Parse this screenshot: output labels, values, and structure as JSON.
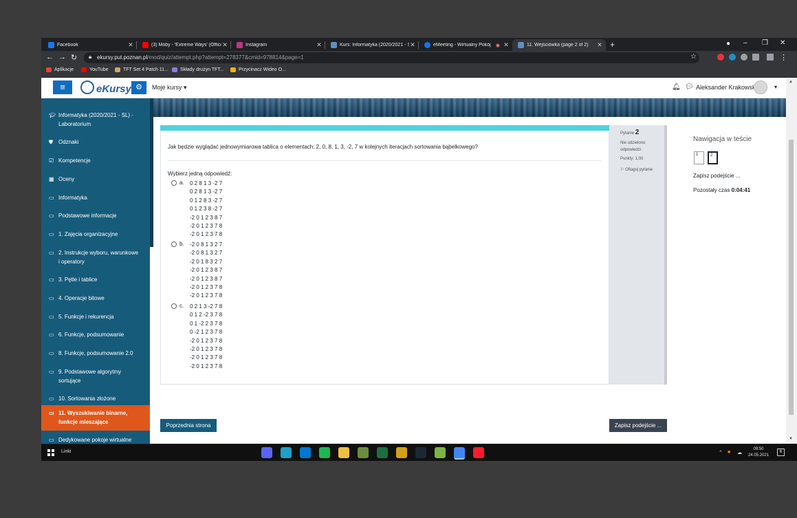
{
  "browser": {
    "tabs": [
      {
        "title": "Facebook",
        "favicon_color": "#1877f2"
      },
      {
        "title": "(3) Moby - 'Extreme Ways' (Offici",
        "favicon_color": "#ff0000"
      },
      {
        "title": "Instagram",
        "favicon_color": "#c13584"
      },
      {
        "title": "Kurs: Informatyka (2020/2021 - S",
        "favicon_color": "#5d8fc4"
      },
      {
        "title": "eMeeting - Wirtualny Pokój",
        "favicon_color": "#1a73e8"
      },
      {
        "title": "11. Wejściówka (page 2 of 2)",
        "favicon_color": "#5d8fc4"
      }
    ],
    "new_tab": "+",
    "window_controls": {
      "minimize": "–",
      "restore": "❐",
      "close": "✕"
    },
    "url_host": "ekursy.put.poznan.pl",
    "url_path": "/mod/quiz/attempt.php?attempt=278377&cmid=978814&page=1",
    "bookmarks": [
      {
        "label": "Aplikacje",
        "color": "#e94235"
      },
      {
        "label": "YouTube",
        "color": "#ff0000"
      },
      {
        "label": "TFT Set 4 Patch 11...",
        "color": "#c8aa6e"
      },
      {
        "label": "Składy drużyn TFT...",
        "color": "#8a7fd6"
      },
      {
        "label": "Przycinacz Wideo O...",
        "color": "#f4b400"
      }
    ]
  },
  "navbar": {
    "logo_text": "eKursy",
    "my_courses": "Moje kursy",
    "user_name": "Aleksander Krakowski"
  },
  "sidebar": {
    "items": [
      {
        "label": "Informatyka (2020/2021 - SL) - Laboratorium",
        "icon": "graduation-cap-icon",
        "glyph": "🎓"
      },
      {
        "label": "Odznaki",
        "icon": "shield-icon",
        "glyph": "⛊"
      },
      {
        "label": "Kompetencje",
        "icon": "checkbox-icon",
        "glyph": "☑"
      },
      {
        "label": "Oceny",
        "icon": "table-icon",
        "glyph": "▦"
      },
      {
        "label": "Informatyka",
        "icon": "folder-icon",
        "glyph": "▭"
      },
      {
        "label": "Podstawowe informacje",
        "icon": "folder-icon",
        "glyph": "▭"
      },
      {
        "label": "1. Zajęcia organizacyjne",
        "icon": "folder-icon",
        "glyph": "▭"
      },
      {
        "label": "2. Instrukcje wyboru, warunkowe i operatory",
        "icon": "folder-icon",
        "glyph": "▭"
      },
      {
        "label": "3. Pętle i tablice",
        "icon": "folder-icon",
        "glyph": "▭"
      },
      {
        "label": "4. Operacje bitowe",
        "icon": "folder-icon",
        "glyph": "▭"
      },
      {
        "label": "5. Funkcje i rekurencja",
        "icon": "folder-icon",
        "glyph": "▭"
      },
      {
        "label": "6. Funkcje, podsumowanie",
        "icon": "folder-icon",
        "glyph": "▭"
      },
      {
        "label": "8. Funkcje, podsumowanie 2.0",
        "icon": "folder-icon",
        "glyph": "▭"
      },
      {
        "label": "9. Podstawowe algorytmy sortujące",
        "icon": "folder-icon",
        "glyph": "▭"
      },
      {
        "label": "10. Sortowania złożone",
        "icon": "folder-icon",
        "glyph": "▭"
      },
      {
        "label": "11. Wyszukiwanie binarne, funkcje mieszające",
        "icon": "folder-icon",
        "glyph": "▭"
      },
      {
        "label": "Dedykowane pokoje wirtualne",
        "icon": "folder-icon",
        "glyph": "▭"
      }
    ]
  },
  "question": {
    "info_label": "Pytanie",
    "number": "2",
    "state": "Nie udzielono odpowiedzi",
    "marks": "Punkty: 1,00",
    "flag": "Oflaguj pytanie",
    "text": "Jak będzie wyglądać jednowymiarowa tablica o elementach: 2, 0, 8, 1, 3, -2, 7 w kolejnych iteracjach sortowania bąbelkowego?",
    "prompt": "Wybierz jedną odpowiedź:",
    "options": [
      {
        "letter": "a.",
        "lines": [
          "0 2 8 1 3 -2 7",
          "0 2 8 1 3 -2 7",
          "0 1 2 8 3 -2 7",
          "0 1 2 3 8 -2 7",
          "-2 0 1 2 3 8 7",
          "-2 0 1 2 3 7 8",
          "-2 0 1 2 3 7 8"
        ]
      },
      {
        "letter": "b.",
        "lines": [
          "-2 0 8 1 3 2 7",
          "-2 0 8 1 3 2 7",
          "-2 0 1 8 3 2 7",
          "-2 0 1 2 3 8 7",
          "-2 0 1 2 3 8 7",
          "-2 0 1 2 3 7 8",
          "-2 0 1 2 3 7 8"
        ]
      },
      {
        "letter": "c.",
        "lines": [
          "0 2 1 3 -2 7 8",
          "0 1 2 -2 3 7 8",
          "0 1 -2 2 3 7 8",
          "0 -2 1 2 3 7 8",
          "-2 0 1 2 3 7 8",
          "-2 0 1 2 3 7 8",
          "-2 0 1 2 3 7 8",
          "-2 0 1 2 3 7 8"
        ]
      }
    ]
  },
  "quiz_nav": {
    "title": "Nawigacja w teście",
    "boxes": [
      "1",
      "2"
    ],
    "current": "2",
    "save_link": "Zapisz podejście ...",
    "time_label": "Pozostały czas",
    "time_value": "0:04:41"
  },
  "buttons": {
    "prev": "Poprzednia strona",
    "save": "Zapisz podejście ..."
  },
  "taskbar": {
    "search": "Linki",
    "apps": [
      {
        "name": "discord-app-icon",
        "color": "#5865f2"
      },
      {
        "name": "edge-app-icon",
        "color": "#1da1c8"
      },
      {
        "name": "mail-app-icon",
        "color": "#0078d4"
      },
      {
        "name": "spotify-app-icon",
        "color": "#1db954"
      },
      {
        "name": "file-explorer-app-icon",
        "color": "#f0c040"
      },
      {
        "name": "minecraft-app-icon",
        "color": "#6b8e3a"
      },
      {
        "name": "excel-app-icon",
        "color": "#1d6f42"
      },
      {
        "name": "riot-app-icon",
        "color": "#d4a017"
      },
      {
        "name": "steam-app-icon",
        "color": "#1b2838"
      },
      {
        "name": "notepad-app-icon",
        "color": "#7cb342"
      },
      {
        "name": "chrome-app-icon",
        "color": "#4285f4"
      },
      {
        "name": "opera-app-icon",
        "color": "#ff1b2d"
      }
    ],
    "time": "09:50",
    "date": "24.05.2021",
    "notifications": "6"
  }
}
